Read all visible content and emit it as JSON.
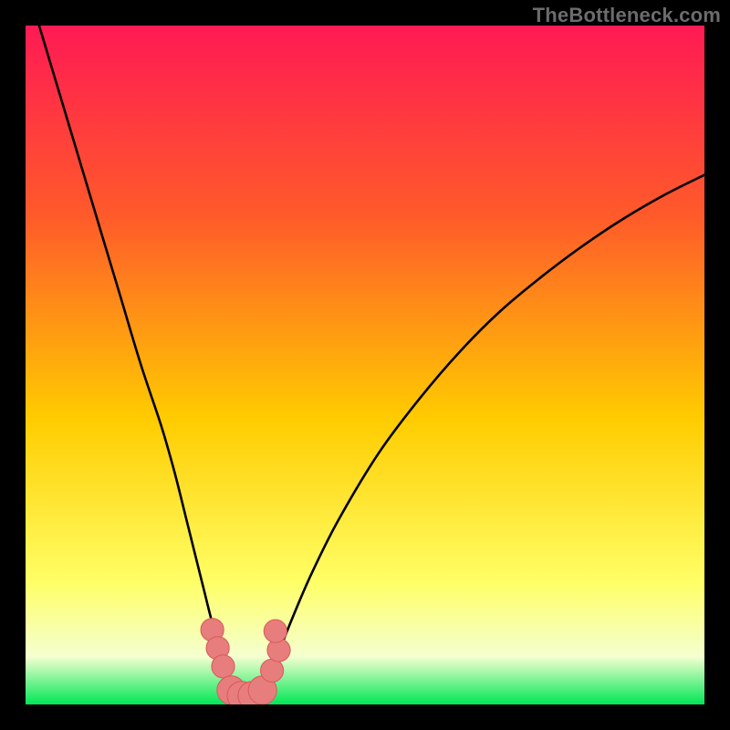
{
  "watermark": "TheBottleneck.com",
  "colors": {
    "frame": "#000000",
    "gradient_top": "#ff1a54",
    "gradient_upper": "#ff5a2a",
    "gradient_mid": "#ffcc00",
    "gradient_lower": "#ffff66",
    "gradient_pale": "#f4ffd0",
    "gradient_bottom": "#00e756",
    "curve": "#000000",
    "marker_fill": "#e77d7d",
    "marker_stroke": "#d85a5a"
  },
  "chart_data": {
    "type": "line",
    "title": "",
    "xlabel": "",
    "ylabel": "",
    "xlim": [
      0,
      100
    ],
    "ylim": [
      0,
      100
    ],
    "series": [
      {
        "name": "bottleneck-curve",
        "x": [
          2,
          5,
          8,
          11,
          14,
          17,
          20,
          22,
          24,
          26,
          27.5,
          29,
          30.5,
          32,
          33.5,
          35,
          37,
          39,
          42,
          46,
          52,
          58,
          64,
          70,
          76,
          82,
          88,
          94,
          100
        ],
        "y": [
          100,
          90,
          80,
          70,
          60,
          50,
          41,
          34,
          26,
          18,
          12,
          7,
          3,
          1.2,
          1.2,
          3,
          7,
          12,
          19,
          27,
          37,
          45,
          52,
          58,
          63,
          67.5,
          71.5,
          75,
          78
        ]
      }
    ],
    "markers": [
      {
        "x": 27.5,
        "y": 11,
        "r": 1.7
      },
      {
        "x": 28.3,
        "y": 8.3,
        "r": 1.7
      },
      {
        "x": 29.1,
        "y": 5.6,
        "r": 1.7
      },
      {
        "x": 30.3,
        "y": 2.1,
        "r": 2.1
      },
      {
        "x": 31.8,
        "y": 1.3,
        "r": 2.1
      },
      {
        "x": 33.4,
        "y": 1.3,
        "r": 2.1
      },
      {
        "x": 34.9,
        "y": 2.1,
        "r": 2.1
      },
      {
        "x": 36.3,
        "y": 5.0,
        "r": 1.7
      },
      {
        "x": 37.3,
        "y": 8.0,
        "r": 1.7
      },
      {
        "x": 36.8,
        "y": 10.8,
        "r": 1.7
      }
    ]
  }
}
